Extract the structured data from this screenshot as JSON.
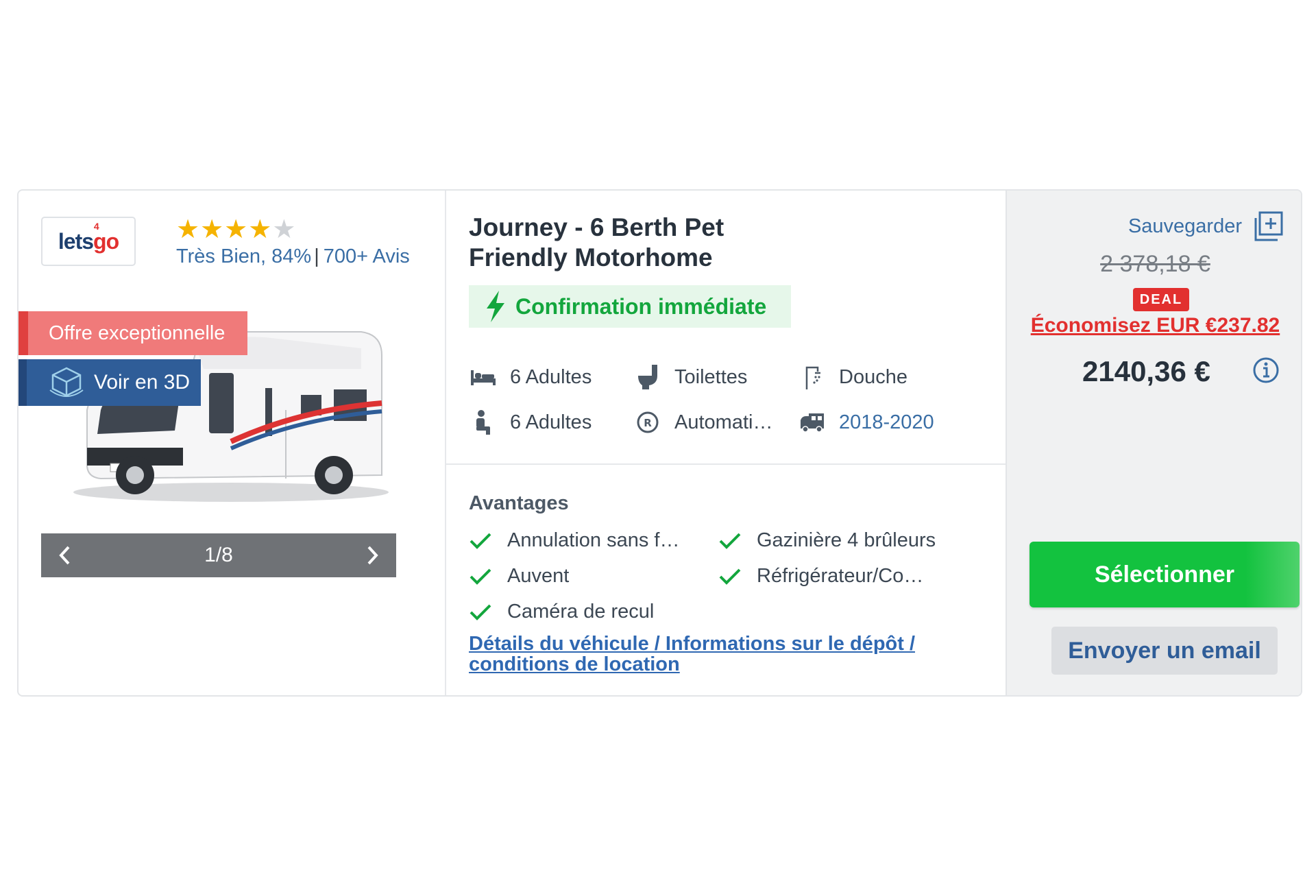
{
  "brand": {
    "logo_text_main": "lets",
    "logo_text_accent": "go",
    "logo_superscript": "4"
  },
  "rating": {
    "stars_filled": 4,
    "stars_total": 5,
    "label": "Très Bien, 84%",
    "separator": "|",
    "reviews": "700+ Avis"
  },
  "badges": {
    "offer": "Offre exceptionnelle",
    "view3d": "Voir en 3D"
  },
  "carousel": {
    "counter": "1/8"
  },
  "listing": {
    "title": "Journey - 6 Berth Pet Friendly Motorhome",
    "confirmation": "Confirmation immédiate"
  },
  "features": [
    {
      "icon": "bed-icon",
      "label": "6 Adultes"
    },
    {
      "icon": "toilet-icon",
      "label": "Toilettes"
    },
    {
      "icon": "shower-icon",
      "label": "Douche"
    },
    {
      "icon": "seat-icon",
      "label": "6 Adultes"
    },
    {
      "icon": "gearbox-icon",
      "label": "Automati…"
    },
    {
      "icon": "motorhome-icon",
      "label": "2018-2020"
    }
  ],
  "advantages": {
    "title": "Avantages",
    "items": [
      "Annulation sans f…",
      "Gazinière 4 brûleurs",
      "Auvent",
      "Réfrigérateur/Co…",
      "Caméra de recul"
    ]
  },
  "details_link": "Détails du véhicule / Informations sur le dépôt / conditions de location",
  "pricing": {
    "save_label": "Sauvegarder",
    "old_price": "2 378,18 €",
    "deal": "DEAL",
    "savings": "Économisez EUR €237.82",
    "price": "2140,36 €"
  },
  "actions": {
    "select": "Sélectionner",
    "email": "Envoyer un email"
  },
  "colors": {
    "accent_blue": "#3a6ea5",
    "link_blue": "#2f68b2",
    "brand_red": "#e2302f",
    "green": "#13c23f",
    "confirm_green": "#13a63d"
  }
}
